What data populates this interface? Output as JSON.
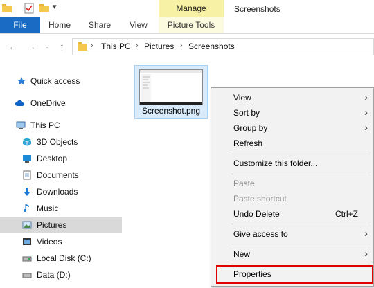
{
  "window": {
    "title": "Screenshots"
  },
  "ribbon": {
    "manage_label": "Manage",
    "tabs": [
      {
        "label": "File"
      },
      {
        "label": "Home"
      },
      {
        "label": "Share"
      },
      {
        "label": "View"
      },
      {
        "label": "Picture Tools"
      }
    ]
  },
  "address": {
    "breadcrumbs": [
      "This PC",
      "Pictures",
      "Screenshots"
    ],
    "separator": "›"
  },
  "nav_pane": {
    "items": [
      {
        "label": "Quick access",
        "icon": "star-icon"
      },
      {
        "label": "OneDrive",
        "icon": "cloud-icon"
      },
      {
        "label": "This PC",
        "icon": "computer-icon"
      },
      {
        "label": "3D Objects",
        "icon": "cube-icon"
      },
      {
        "label": "Desktop",
        "icon": "desktop-icon"
      },
      {
        "label": "Documents",
        "icon": "document-icon"
      },
      {
        "label": "Downloads",
        "icon": "download-icon"
      },
      {
        "label": "Music",
        "icon": "music-icon"
      },
      {
        "label": "Pictures",
        "icon": "pictures-icon",
        "selected": true
      },
      {
        "label": "Videos",
        "icon": "video-icon"
      },
      {
        "label": "Local Disk (C:)",
        "icon": "drive-icon"
      },
      {
        "label": "Data (D:)",
        "icon": "drive-icon"
      }
    ]
  },
  "files": [
    {
      "name": "Screenshot.png"
    }
  ],
  "context_menu": {
    "items": [
      {
        "label": "View",
        "submenu": true
      },
      {
        "label": "Sort by",
        "submenu": true
      },
      {
        "label": "Group by",
        "submenu": true
      },
      {
        "label": "Refresh"
      },
      {
        "label": "Customize this folder..."
      },
      {
        "label": "Paste",
        "disabled": true
      },
      {
        "label": "Paste shortcut",
        "disabled": true
      },
      {
        "label": "Undo Delete",
        "shortcut": "Ctrl+Z"
      },
      {
        "label": "Give access to",
        "submenu": true
      },
      {
        "label": "New",
        "submenu": true
      },
      {
        "label": "Properties",
        "highlighted": true
      }
    ],
    "submenu_glyph": "›"
  },
  "colors": {
    "file_tab": "#1a6bc4",
    "manage": "#f6f1a4",
    "selection": "#d9ebfa",
    "highlight_box": "#e00000"
  }
}
